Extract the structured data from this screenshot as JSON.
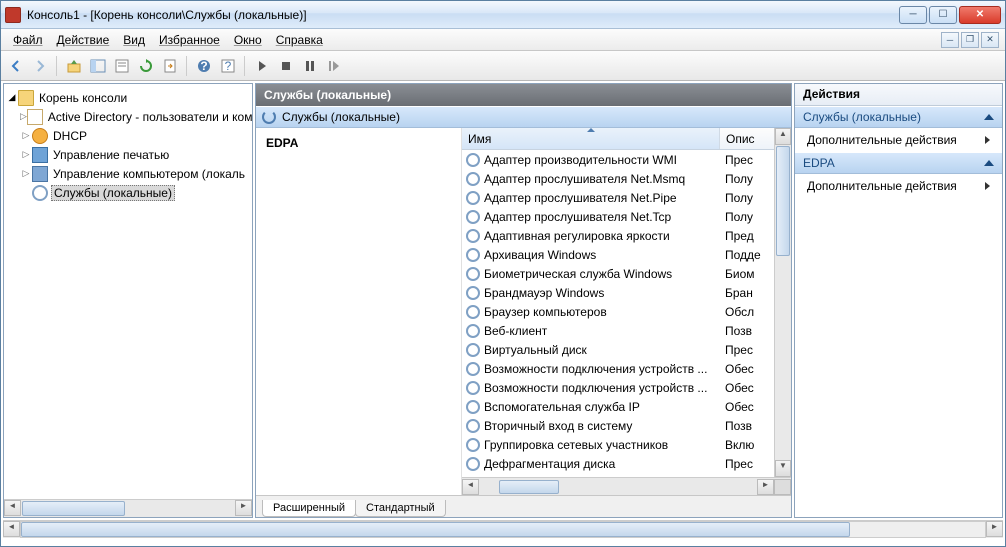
{
  "title": "Консоль1 - [Корень консоли\\Службы (локальные)]",
  "menu": [
    "Файл",
    "Действие",
    "Вид",
    "Избранное",
    "Окно",
    "Справка"
  ],
  "tree": {
    "root": "Корень консоли",
    "items": [
      "Active Directory - пользователи и ком",
      "DHCP",
      "Управление печатью",
      "Управление компьютером (локаль",
      "Службы (локальные)"
    ]
  },
  "center": {
    "header": "Службы (локальные)",
    "sub": "Службы (локальные)",
    "selected": "EDPA",
    "col_name": "Имя",
    "col_desc": "Опис"
  },
  "services": [
    {
      "n": "Адаптер производительности WMI",
      "d": "Прес"
    },
    {
      "n": "Адаптер прослушивателя Net.Msmq",
      "d": "Полу"
    },
    {
      "n": "Адаптер прослушивателя Net.Pipe",
      "d": "Полу"
    },
    {
      "n": "Адаптер прослушивателя Net.Tcp",
      "d": "Полу"
    },
    {
      "n": "Адаптивная регулировка яркости",
      "d": "Пред"
    },
    {
      "n": "Архивация Windows",
      "d": "Подде"
    },
    {
      "n": "Биометрическая служба Windows",
      "d": "Биом"
    },
    {
      "n": "Брандмауэр Windows",
      "d": "Бран"
    },
    {
      "n": "Браузер компьютеров",
      "d": "Обсл"
    },
    {
      "n": "Веб-клиент",
      "d": "Позв"
    },
    {
      "n": "Виртуальный диск",
      "d": "Прес"
    },
    {
      "n": "Возможности подключения устройств ...",
      "d": "Обес"
    },
    {
      "n": "Возможности подключения устройств ...",
      "d": "Обес"
    },
    {
      "n": "Вспомогательная служба IP",
      "d": "Обес"
    },
    {
      "n": "Вторичный вход в систему",
      "d": "Позв"
    },
    {
      "n": "Группировка сетевых участников",
      "d": "Вклю"
    },
    {
      "n": "Дефрагментация диска",
      "d": "Прес"
    }
  ],
  "tabs": [
    "Расширенный",
    "Стандартный"
  ],
  "actions": {
    "header": "Действия",
    "group1": "Службы (локальные)",
    "more": "Дополнительные действия",
    "group2": "EDPA"
  }
}
